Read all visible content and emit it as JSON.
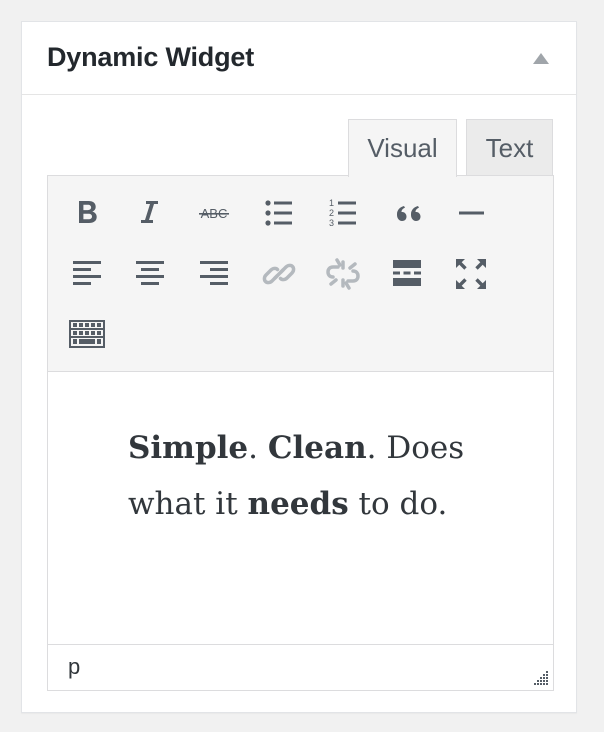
{
  "widget": {
    "title": "Dynamic Widget",
    "toggle_icon": "triangle-up-icon"
  },
  "tabs": [
    {
      "label": "Visual",
      "active": true
    },
    {
      "label": "Text",
      "active": false
    }
  ],
  "toolbar": {
    "buttons": [
      "bold-icon",
      "italic-icon",
      "strikethrough-icon",
      "bullet-list-icon",
      "numbered-list-icon",
      "blockquote-icon",
      "horizontal-rule-icon",
      "align-left-icon",
      "align-center-icon",
      "align-right-icon",
      "insert-link-icon",
      "remove-link-icon",
      "read-more-icon",
      "fullscreen-icon",
      "toolbar-toggle-icon"
    ],
    "strikethrough_glyph": "ABC",
    "numbered_glyphs": [
      "1",
      "2",
      "3"
    ]
  },
  "content": {
    "segments": [
      {
        "text": "Simple",
        "bold": true
      },
      {
        "text": ". ",
        "bold": false
      },
      {
        "text": "Clean",
        "bold": true
      },
      {
        "text": ". Does what it ",
        "bold": false
      },
      {
        "text": "needs",
        "bold": true
      },
      {
        "text": " to do.",
        "bold": false
      }
    ]
  },
  "status": {
    "path": "p"
  },
  "colors": {
    "icon": "#555d66",
    "icon_disabled": "#b4b9be",
    "toolbar_bg": "#f5f5f5",
    "border": "#dcdcde"
  }
}
